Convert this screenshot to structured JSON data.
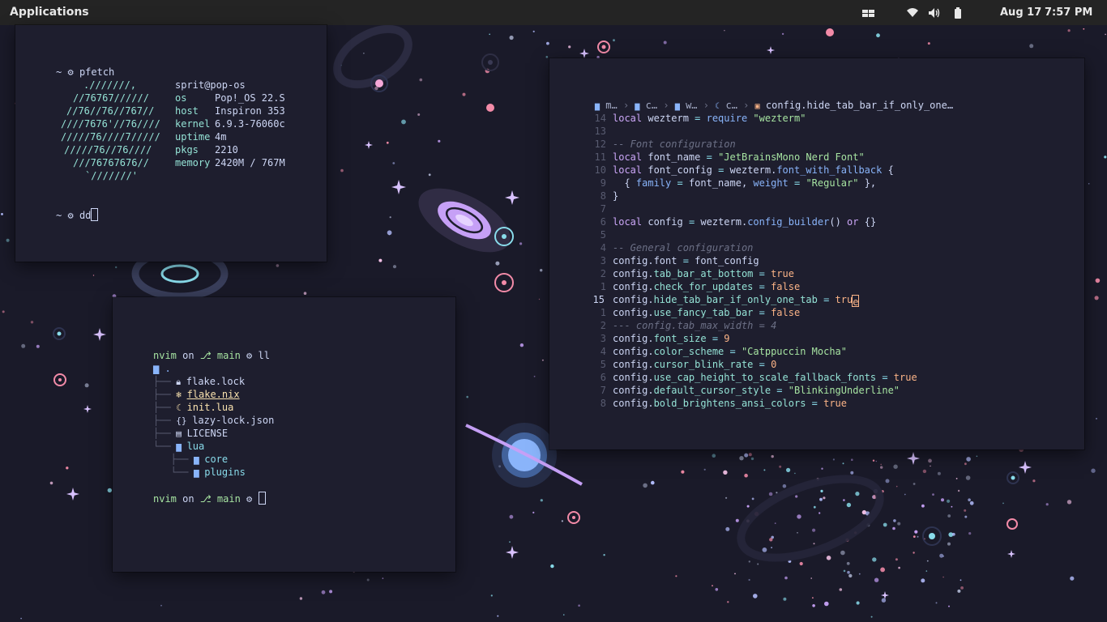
{
  "topbar": {
    "apps_label": "Applications",
    "date": "Aug 17",
    "time": "7:57 PM",
    "tray_icons": [
      "workspaces-icon",
      "wifi-icon",
      "volume-icon",
      "battery-icon"
    ]
  },
  "pfetch": {
    "prompt_symbol": "~",
    "command": "pfetch",
    "logo": [
      ".///////,",
      "//76767//////",
      "//76//76//767//",
      "////7676'//76////",
      "/////76////7/////",
      "/////76//76////",
      "///76767676//",
      "`///////'"
    ],
    "user": "sprit@pop-os",
    "info": [
      {
        "key": "os",
        "value": "Pop!_OS 22.S"
      },
      {
        "key": "host",
        "value": "Inspiron 353"
      },
      {
        "key": "kernel",
        "value": "6.9.3-76060c"
      },
      {
        "key": "uptime",
        "value": "4m"
      },
      {
        "key": "pkgs",
        "value": "2210"
      },
      {
        "key": "memory",
        "value": "2420M / 767M"
      }
    ],
    "prompt2_cmd": "dd"
  },
  "tree": {
    "dir": "nvim",
    "on": "on",
    "branch": "main",
    "command": "ll",
    "root": ".",
    "items": [
      {
        "name": "flake.lock",
        "icon": "lock-icon",
        "color": "#cdd6f4"
      },
      {
        "name": "flake.nix",
        "icon": "nix-icon",
        "color": "#f9e2af"
      },
      {
        "name": "init.lua",
        "icon": "lua-icon",
        "color": "#f9e2af"
      },
      {
        "name": "lazy-lock.json",
        "icon": "json-icon",
        "color": "#cdd6f4"
      },
      {
        "name": "LICENSE",
        "icon": "license-icon",
        "color": "#cdd6f4"
      },
      {
        "name": "lua",
        "icon": "folder-icon",
        "color": "#89dceb"
      },
      {
        "name": "core",
        "icon": "folder-icon",
        "color": "#89dceb"
      },
      {
        "name": "plugins",
        "icon": "folder-icon",
        "color": "#89dceb"
      }
    ]
  },
  "editor": {
    "breadcrumb": [
      "m…",
      "c…",
      "w…",
      "c…",
      "config.hide_tab_bar_if_only_one…"
    ],
    "line_numbers": [
      "14",
      "13",
      "12",
      "11",
      "10",
      "9",
      "8",
      "7",
      "6",
      "5",
      "4",
      "3",
      "2",
      "1",
      "15",
      "1",
      "2",
      "3",
      "4",
      "5",
      "6",
      "7",
      "8"
    ],
    "lines": [
      [
        [
          "local ",
          "mauve"
        ],
        [
          "wezterm ",
          "text"
        ],
        [
          "= ",
          "sky"
        ],
        [
          "require ",
          "blue"
        ],
        [
          "\"wezterm\"",
          "green"
        ]
      ],
      [],
      [
        [
          "-- Font configuration",
          "gray"
        ]
      ],
      [
        [
          "local ",
          "mauve"
        ],
        [
          "font_name ",
          "text"
        ],
        [
          "= ",
          "sky"
        ],
        [
          "\"JetBrainsMono Nerd Font\"",
          "green"
        ]
      ],
      [
        [
          "local ",
          "mauve"
        ],
        [
          "font_config ",
          "text"
        ],
        [
          "= ",
          "sky"
        ],
        [
          "wezterm.",
          "text"
        ],
        [
          "font_with_fallback ",
          "blue"
        ],
        [
          "{",
          "text"
        ]
      ],
      [
        [
          "  { ",
          "text"
        ],
        [
          "family ",
          "blue"
        ],
        [
          "= ",
          "sky"
        ],
        [
          "font_name, ",
          "text"
        ],
        [
          "weight ",
          "blue"
        ],
        [
          "= ",
          "sky"
        ],
        [
          "\"Regular\"",
          "green"
        ],
        [
          " },",
          "text"
        ]
      ],
      [
        [
          "}",
          "text"
        ]
      ],
      [],
      [
        [
          "local ",
          "mauve"
        ],
        [
          "config ",
          "text"
        ],
        [
          "= ",
          "sky"
        ],
        [
          "wezterm.",
          "text"
        ],
        [
          "config_builder",
          "blue"
        ],
        [
          "() ",
          "text"
        ],
        [
          "or ",
          "mauve"
        ],
        [
          "{}",
          "text"
        ]
      ],
      [],
      [
        [
          "-- General configuration",
          "gray"
        ]
      ],
      [
        [
          "config.",
          "text"
        ],
        [
          "font ",
          "text"
        ],
        [
          "= ",
          "sky"
        ],
        [
          "font_config",
          "text"
        ]
      ],
      [
        [
          "config.",
          "text"
        ],
        [
          "tab_bar_at_bottom ",
          "teal"
        ],
        [
          "= ",
          "sky"
        ],
        [
          "true",
          "orange"
        ]
      ],
      [
        [
          "config.",
          "text"
        ],
        [
          "check_for_updates ",
          "teal"
        ],
        [
          "= ",
          "sky"
        ],
        [
          "false",
          "orange"
        ]
      ],
      [
        [
          "config.",
          "text"
        ],
        [
          "hide_tab_bar_if_only_one_tab ",
          "teal"
        ],
        [
          "= ",
          "sky"
        ],
        [
          "tru",
          "orange"
        ],
        [
          "e",
          "cursor"
        ]
      ],
      [
        [
          "config.",
          "text"
        ],
        [
          "use_fancy_tab_bar ",
          "teal"
        ],
        [
          "= ",
          "sky"
        ],
        [
          "false",
          "orange"
        ]
      ],
      [
        [
          "--- config.tab_max_width = 4",
          "gray"
        ]
      ],
      [
        [
          "config.",
          "text"
        ],
        [
          "font_size ",
          "teal"
        ],
        [
          "= ",
          "sky"
        ],
        [
          "9",
          "orange"
        ]
      ],
      [
        [
          "config.",
          "text"
        ],
        [
          "color_scheme ",
          "teal"
        ],
        [
          "= ",
          "sky"
        ],
        [
          "\"Catppuccin Mocha\"",
          "green"
        ]
      ],
      [
        [
          "config.",
          "text"
        ],
        [
          "cursor_blink_rate ",
          "teal"
        ],
        [
          "= ",
          "sky"
        ],
        [
          "0",
          "orange"
        ]
      ],
      [
        [
          "config.",
          "text"
        ],
        [
          "use_cap_height_to_scale_fallback_fonts ",
          "teal"
        ],
        [
          "= ",
          "sky"
        ],
        [
          "true",
          "orange"
        ]
      ],
      [
        [
          "config.",
          "text"
        ],
        [
          "default_cursor_style ",
          "teal"
        ],
        [
          "= ",
          "sky"
        ],
        [
          "\"BlinkingUnderline\"",
          "green"
        ]
      ],
      [
        [
          "config.",
          "text"
        ],
        [
          "bold_brightens_ansi_colors ",
          "teal"
        ],
        [
          "= ",
          "sky"
        ],
        [
          "true",
          "orange"
        ]
      ]
    ]
  }
}
